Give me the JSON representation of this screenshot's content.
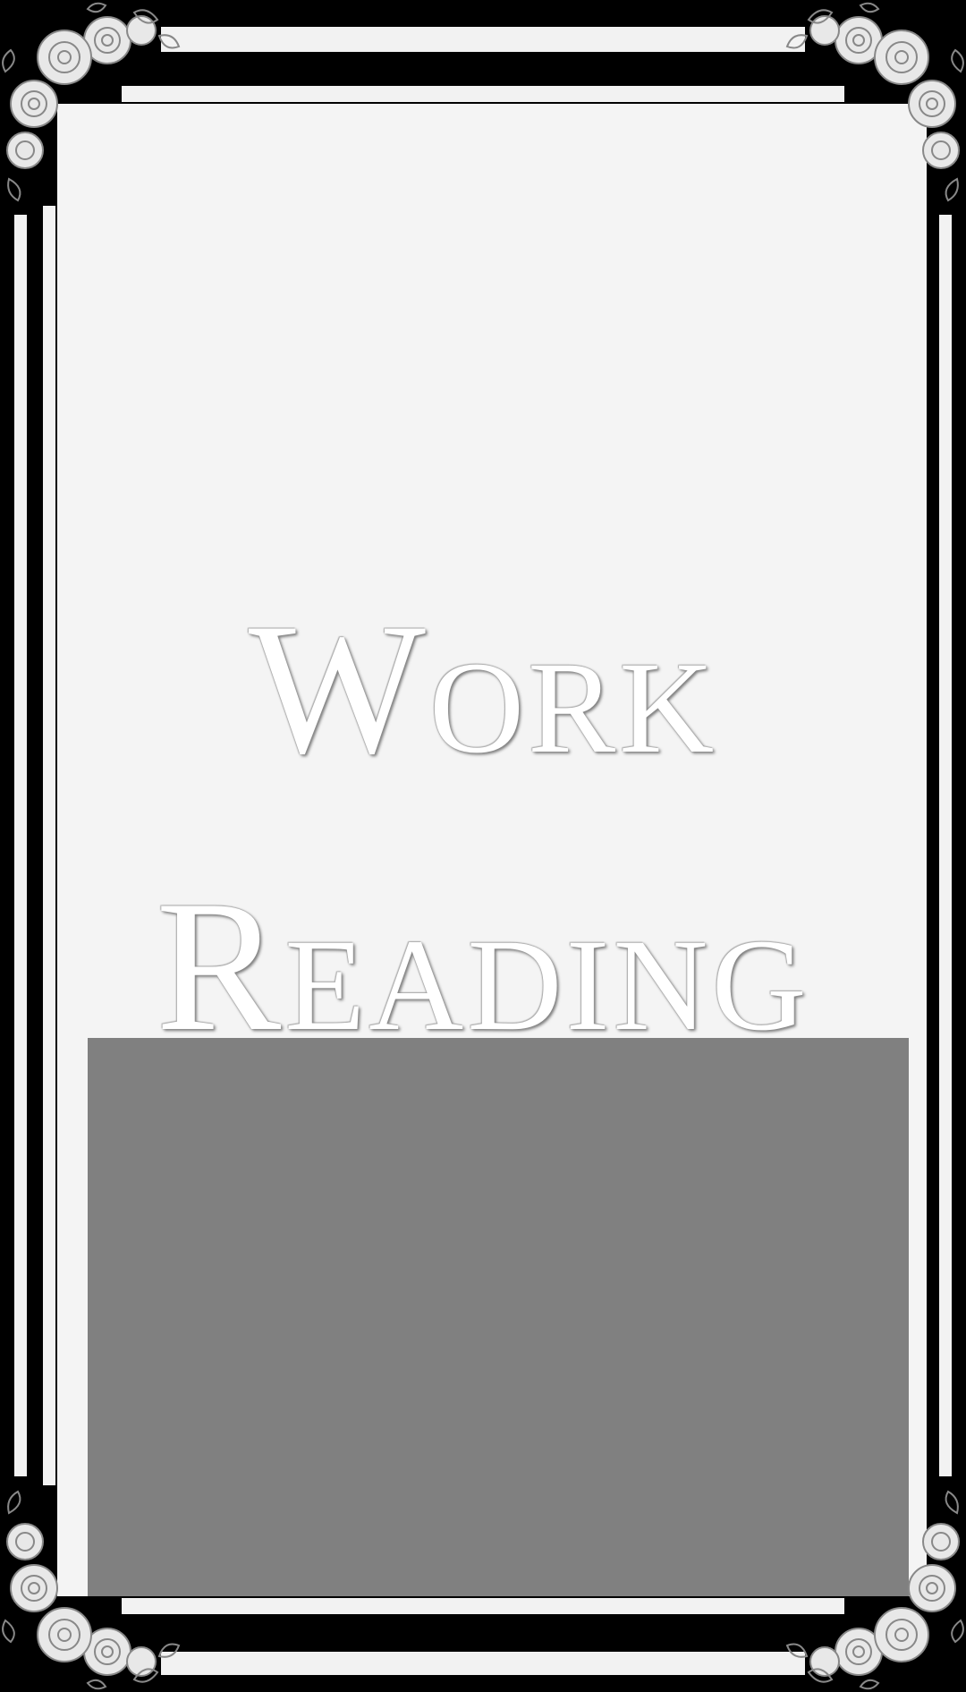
{
  "title": {
    "line1": "Work",
    "line2": "Reading"
  },
  "ornaments": {
    "icon": "rose-corner-icon"
  },
  "colors": {
    "background": "#000000",
    "panel": "#f4f4f4",
    "lower_panel": "#808080",
    "text": "#ffffff",
    "frame": "#f2f2f2"
  }
}
